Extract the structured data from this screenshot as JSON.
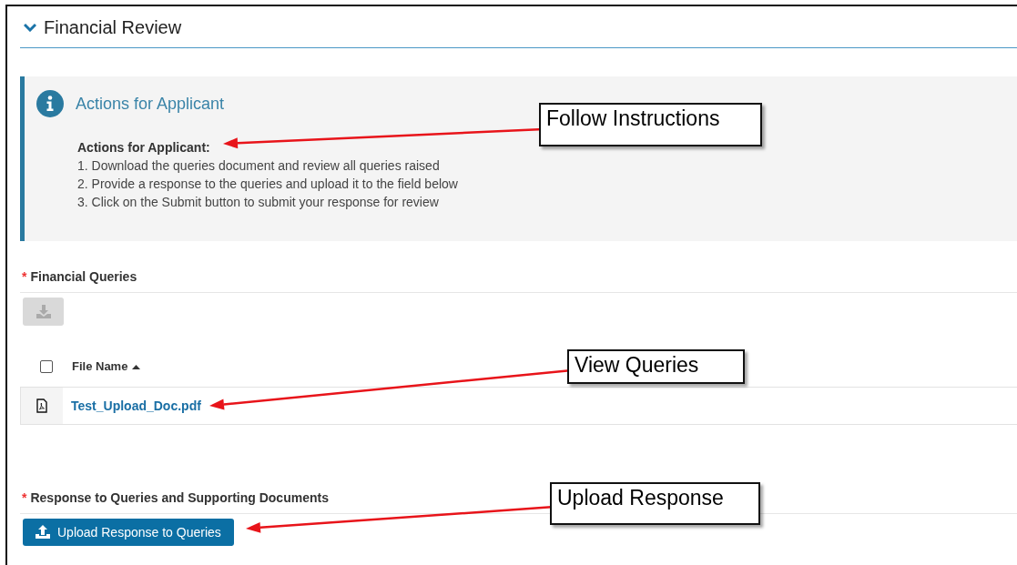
{
  "section": {
    "title": "Financial Review",
    "expanded": true
  },
  "info_panel": {
    "title": "Actions for Applicant",
    "heading": "Actions for Applicant:",
    "lines": [
      "1. Download the queries document and review all queries raised",
      "2. Provide a response to the queries and upload it to the field below",
      "3. Click on the Submit button to submit your response for review"
    ]
  },
  "financial_queries": {
    "required_mark": "*",
    "label": "Financial Queries",
    "download_disabled": true,
    "table": {
      "select_all_checked": false,
      "columns": [
        {
          "label": "File Name",
          "sort_ascending": true
        }
      ],
      "rows": [
        {
          "file_name": "Test_Upload_Doc.pdf"
        }
      ]
    }
  },
  "response": {
    "required_mark": "*",
    "label": "Response to Queries and Supporting Documents",
    "button": "Upload Response to Queries"
  },
  "annotations": [
    {
      "text": "Follow Instructions"
    },
    {
      "text": "View Queries"
    },
    {
      "text": "Upload Response"
    }
  ]
}
